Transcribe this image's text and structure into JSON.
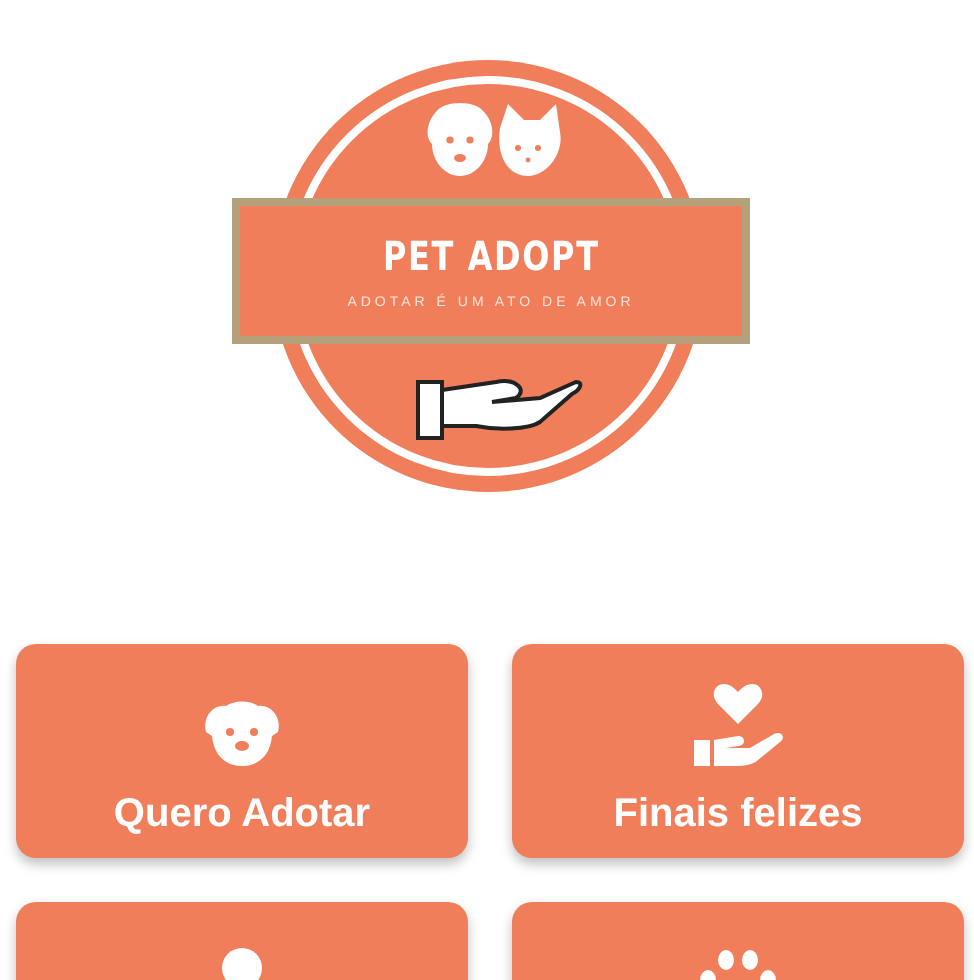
{
  "logo": {
    "title": "PET ADOPT",
    "tagline": "ADOTAR É UM ATO DE AMOR"
  },
  "menu": [
    {
      "kind": "dog",
      "label": "Quero Adotar"
    },
    {
      "kind": "heart-hand",
      "label": "Finais felizes"
    },
    {
      "kind": "person"
    },
    {
      "kind": "paw"
    }
  ]
}
